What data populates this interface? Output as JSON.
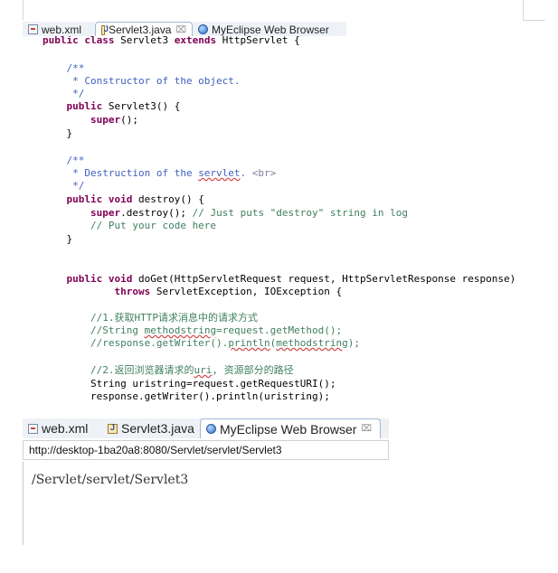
{
  "editor_tabs": [
    {
      "label": "web.xml",
      "icon": "xml-file-icon",
      "closable": false
    },
    {
      "label": "Servlet3.java",
      "icon": "java-file-icon",
      "closable": true
    },
    {
      "label": "MyEclipse Web Browser",
      "icon": "globe-icon",
      "closable": false
    }
  ],
  "close_glyph": "⌧",
  "code": {
    "lines": [
      "public class Servlet3 extends HttpServlet {",
      "    /**",
      "     * Constructor of the object.",
      "     */",
      "    public Servlet3() {",
      "        super();",
      "    }",
      "    /**",
      "     * Destruction of the servlet. <br>",
      "     */",
      "    public void destroy() {",
      "        super.destroy(); // Just puts \"destroy\" string in log",
      "        // Put your code here",
      "    }",
      "    public void doGet(HttpServletRequest request, HttpServletResponse response)",
      "            throws ServletException, IOException {",
      "        //1.获取HTTP请求消息中的请求方式",
      "        //String methodstring=request.getMethod();",
      "        //response.getWriter().println(methodstring);",
      "        //2.返回浏览器请求的uri, 资源部分的路径",
      "        String uristring=request.getRequestURI();",
      "        response.getWriter().println(uristring);"
    ]
  },
  "browser_tabs": [
    {
      "label": "web.xml",
      "icon": "xml-file-icon",
      "closable": false
    },
    {
      "label": "Servlet3.java",
      "icon": "java-file-icon",
      "closable": false
    },
    {
      "label": "MyEclipse Web Browser",
      "icon": "globe-icon",
      "closable": true
    }
  ],
  "browser": {
    "url": "http://desktop-1ba20a8:8080/Servlet/servlet/Servlet3",
    "content": "/Servlet/servlet/Servlet3"
  },
  "colors": {
    "keyword": "#7f0055",
    "comment": "#3f7f5f",
    "javadoc": "#3f5fbf",
    "active_tab_border": "#9fb7d6",
    "current_line": "#e8f2fe"
  }
}
